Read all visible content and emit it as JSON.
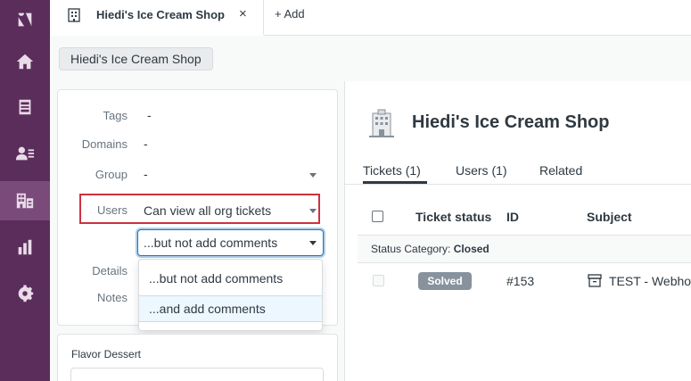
{
  "nav": {
    "items": [
      {
        "name": "logo",
        "active": false
      },
      {
        "name": "home",
        "active": false
      },
      {
        "name": "views",
        "active": false
      },
      {
        "name": "customers",
        "active": false
      },
      {
        "name": "organizations",
        "active": true
      },
      {
        "name": "reporting",
        "active": false
      },
      {
        "name": "admin",
        "active": false
      }
    ]
  },
  "tabbar": {
    "tab_title": "Hiedi's Ice Cream Shop",
    "close": "×",
    "add_label": "+ Add"
  },
  "org_chip": "Hiedi's Ice Cream Shop",
  "fields": {
    "tags": {
      "label": "Tags",
      "value": "-"
    },
    "domains": {
      "label": "Domains",
      "value": "-"
    },
    "group": {
      "label": "Group",
      "value": "-"
    },
    "users": {
      "label": "Users",
      "value": "Can view all org tickets"
    },
    "details": {
      "label": "Details"
    },
    "notes": {
      "label": "Notes"
    }
  },
  "comment_select": {
    "selected": "...but not add comments",
    "options": [
      "...but not add comments",
      "...and add comments"
    ]
  },
  "custom_field": {
    "label": "Flavor Dessert",
    "value": ""
  },
  "main": {
    "title": "Hiedi's Ice Cream Shop",
    "tabs": [
      "Tickets (1)",
      "Users (1)",
      "Related"
    ],
    "columns": [
      "Ticket status",
      "ID",
      "Subject"
    ],
    "group_row": {
      "prefix": "Status Category:",
      "value": "Closed"
    },
    "rows": [
      {
        "status": "Solved",
        "id": "#153",
        "subject": "TEST - Webhook"
      }
    ]
  },
  "colors": {
    "nav_bg": "#5a2d5a",
    "highlight_border": "#cc3340",
    "focus_blue": "#1f73b7",
    "badge_solved": "#87929d"
  }
}
